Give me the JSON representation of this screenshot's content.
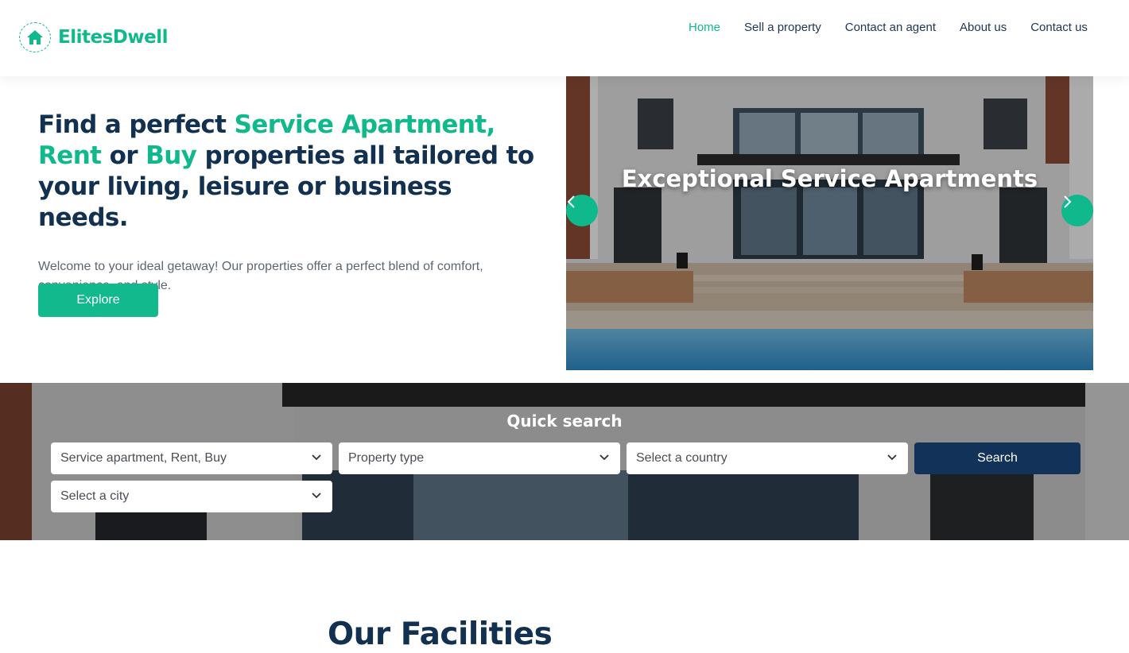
{
  "brand": {
    "name": "ElitesDwell",
    "color": "#10b98c"
  },
  "nav": {
    "items": [
      {
        "label": "Home",
        "active": true
      },
      {
        "label": "Sell a property",
        "active": false
      },
      {
        "label": "Contact an agent",
        "active": false
      },
      {
        "label": "About us",
        "active": false
      },
      {
        "label": "Contact us",
        "active": false
      }
    ]
  },
  "hero": {
    "title_part1": "Find a perfect ",
    "title_accent1": "Service Apartment, Rent",
    "title_part2": " or ",
    "title_accent2": "Buy",
    "title_part3": " properties all tailored to your living, leisure or business needs.",
    "description": "Welcome to your ideal getaway! Our properties offer a perfect blend of comfort, convenience, and style.",
    "cta_label": "Explore"
  },
  "slider": {
    "caption": "Exceptional Service Apartments",
    "prev_icon": "chevron-left-icon",
    "next_icon": "chevron-right-icon"
  },
  "quick_search": {
    "title": "Quick search",
    "listing_select": "Service apartment, Rent, Buy",
    "property_type_select": "Property type",
    "country_select": "Select a country",
    "city_select": "Select a city",
    "search_label": "Search"
  },
  "facilities": {
    "title": "Our Facilities"
  },
  "colors": {
    "accent": "#10b98c",
    "navy": "#12325a",
    "text": "#12304f"
  }
}
